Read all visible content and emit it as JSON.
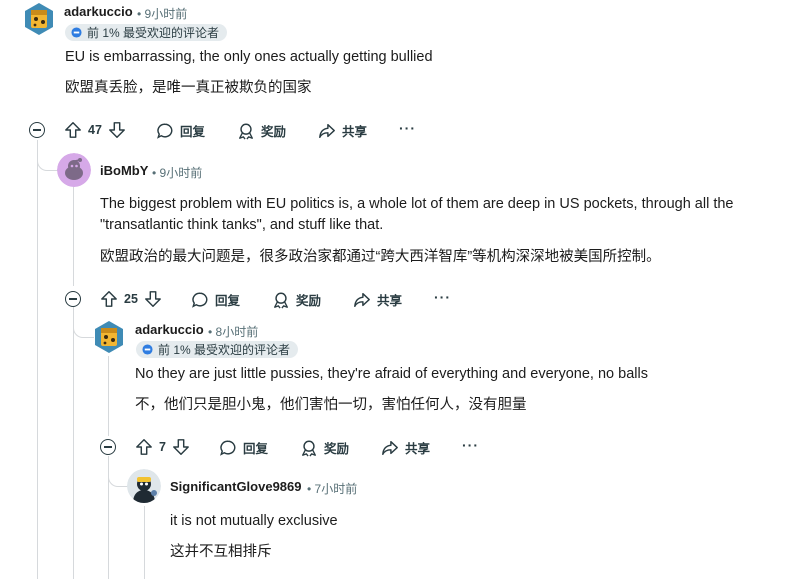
{
  "comments": [
    {
      "username": "adarkuccio",
      "time": "• 9小时前",
      "badge": "前 1% 最受欢迎的评论者",
      "text_en": "EU is embarrassing, the only ones actually getting bullied",
      "text_zh": "欧盟真丢脸，是唯一真正被欺负的国家",
      "votes": "47",
      "reply_label": "回复",
      "award_label": "奖励",
      "share_label": "共享",
      "more_label": "···"
    },
    {
      "username": "iBoMbY",
      "time": "• 9小时前",
      "text_en": "The biggest problem with EU politics is, a whole lot of them are deep in US pockets, through all the \"transatlantic think tanks\", and stuff like that.",
      "text_zh": "欧盟政治的最大问题是，很多政治家都通过“跨大西洋智库”等机构深深地被美国所控制。",
      "votes": "25",
      "reply_label": "回复",
      "award_label": "奖励",
      "share_label": "共享",
      "more_label": "···"
    },
    {
      "username": "adarkuccio",
      "time": "• 8小时前",
      "badge": "前 1% 最受欢迎的评论者",
      "text_en": "No they are just little pussies, they're afraid of everything and everyone, no balls",
      "text_zh": "不，他们只是胆小鬼，他们害怕一切，害怕任何人，没有胆量",
      "votes": "7",
      "reply_label": "回复",
      "award_label": "奖励",
      "share_label": "共享",
      "more_label": "···"
    },
    {
      "username": "SignificantGlove9869",
      "time": "• 7小时前",
      "text_en": "it is not mutually exclusive",
      "text_zh": "这并不互相排斥"
    }
  ],
  "colors": {
    "text": "#1c1c1c",
    "meta": "#576f76",
    "badge_bg": "#e5ebee",
    "thread_line": "#d6d9dc",
    "icon": "#2a3c42"
  },
  "icons": [
    "upvote-icon",
    "downvote-icon",
    "comment-icon",
    "award-icon",
    "share-icon",
    "more-icon",
    "collapse-icon",
    "badge-icon"
  ]
}
